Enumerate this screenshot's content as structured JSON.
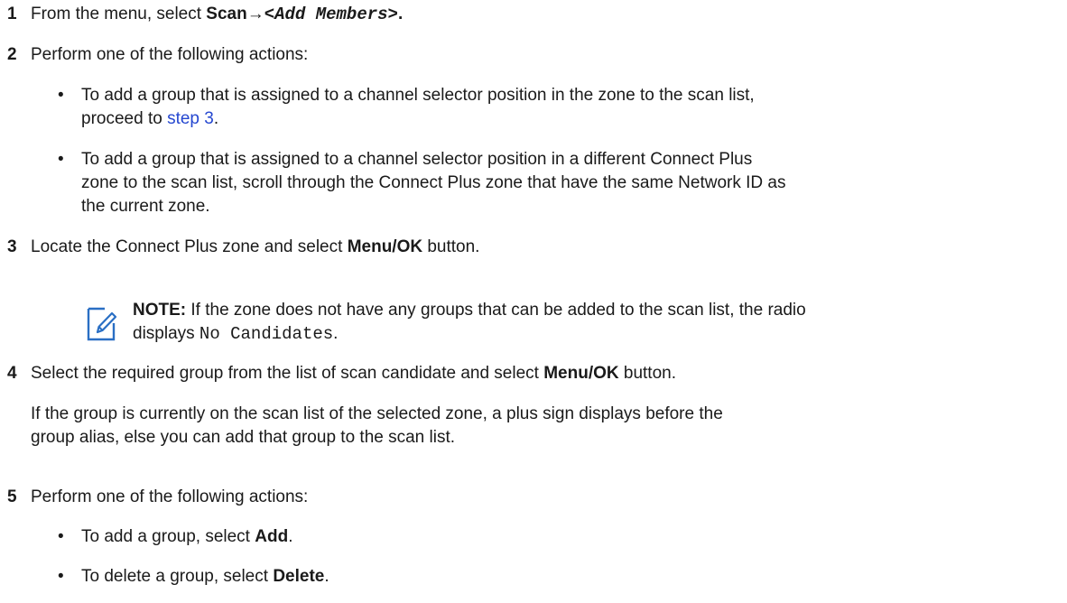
{
  "steps": [
    {
      "number": "1",
      "prefix": "From the menu, select ",
      "bold": "Scan",
      "arrow": "→",
      "code": "<Add Members>",
      "suffix": "."
    },
    {
      "number": "2",
      "text": "Perform one of the following actions:",
      "bullets": [
        {
          "line1": "To add a group that is assigned to a channel selector position in the zone to the scan list,",
          "line2_prefix": "proceed to ",
          "link": "step 3",
          "line2_suffix": "."
        },
        {
          "line1": "To add a group that is assigned to a channel selector position in a different Connect Plus",
          "line2": "zone to the scan list, scroll through the Connect Plus zone that have the same Network ID as",
          "line3": "the current zone."
        }
      ]
    },
    {
      "number": "3",
      "prefix": "Locate the Connect Plus zone and select ",
      "bold": "Menu/OK",
      "suffix": " button.",
      "note": {
        "label": "NOTE:",
        "line1": " If the zone does not have any groups that can be added to the scan list, the radio",
        "line2_prefix": "displays ",
        "code": "No Candidates",
        "line2_suffix": "."
      }
    },
    {
      "number": "4",
      "prefix": "Select the required group from the list of scan candidate and select ",
      "bold": "Menu/OK",
      "suffix": " button.",
      "para_line1": "If the group is currently on the scan list of the selected zone, a plus sign displays before the",
      "para_line2": "group alias, else you can add that group to the scan list."
    },
    {
      "number": "5",
      "text": "Perform one of the following actions:",
      "bullets": [
        {
          "prefix": "To add a group, select ",
          "bold": "Add",
          "suffix": "."
        },
        {
          "prefix": "To delete a group, select ",
          "bold": "Delete",
          "suffix": "."
        }
      ]
    }
  ],
  "bullet_char": "•"
}
